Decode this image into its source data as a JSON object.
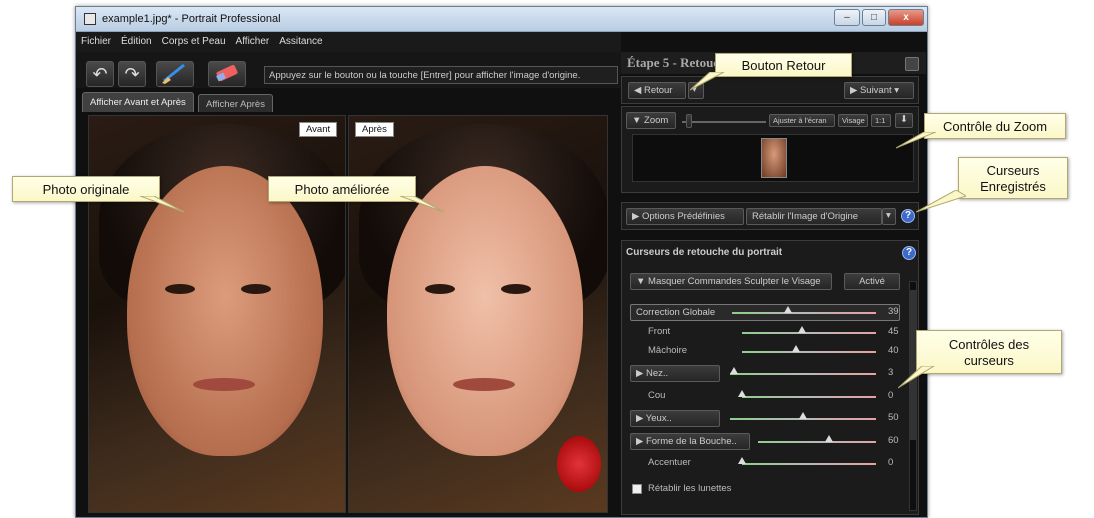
{
  "window": {
    "title": "example1.jpg* - Portrait Professional",
    "minimize_glyph": "–",
    "maximize_glyph": "□",
    "close_glyph": "x"
  },
  "menu": [
    "Fichier",
    "Édition",
    "Corps et Peau",
    "Afficher",
    "Assitance"
  ],
  "toolbar": {
    "undo_icon": "undo-icon",
    "redo_icon": "redo-icon",
    "brush_icon": "brush-icon",
    "eraser_icon": "eraser-icon",
    "hint": "Appuyez sur le bouton ou la touche [Entrer] pour afficher l'image d'origine."
  },
  "tabs": [
    "Afficher Avant et Après",
    "Afficher Après"
  ],
  "photos": {
    "before_label": "Avant",
    "after_label": "Après"
  },
  "panel": {
    "step_title": "Étape 5 - Retouche",
    "nav": {
      "back_label": "Retour",
      "next_label": "Suivant"
    },
    "zoom": {
      "label": "Zoom",
      "fit_label": "Ajuster à l'écran",
      "face_label": "Visage",
      "one_to_one_label": "1:1",
      "level": 0.05
    },
    "presets": {
      "label": "Options Prédéfinies",
      "selected": "Rétablir l'Image d'Origine"
    },
    "sliders_title": "Curseurs de retouche du portrait",
    "sculpt_toggle_label": "Masquer Commandes Sculpter le Visage",
    "sculpt_state": "Activé",
    "sliders": [
      {
        "label": "Correction Globale",
        "value": "39",
        "pos": 0.39
      },
      {
        "label": "Front",
        "value": "45",
        "pos": 0.45
      },
      {
        "label": "Mâchoire",
        "value": "40",
        "pos": 0.4
      },
      {
        "label": "Nez..",
        "value": "3",
        "pos": 0.03
      },
      {
        "label": "Cou",
        "value": "0",
        "pos": 0.0
      },
      {
        "label": "Yeux..",
        "value": "50",
        "pos": 0.5
      },
      {
        "label": "Forme de la Bouche..",
        "value": "60",
        "pos": 0.6
      },
      {
        "label": "Accentuer",
        "value": "0",
        "pos": 0.0
      }
    ],
    "glasses_label": "Rétablir les lunettes"
  },
  "callouts": {
    "back_button": "Bouton Retour",
    "zoom_control": "Contrôle du Zoom",
    "saved_sliders": "Curseurs Enregistrés",
    "slider_controls": "Contrôles des curseurs",
    "original_photo": "Photo originale",
    "improved_photo": "Photo améliorée"
  }
}
